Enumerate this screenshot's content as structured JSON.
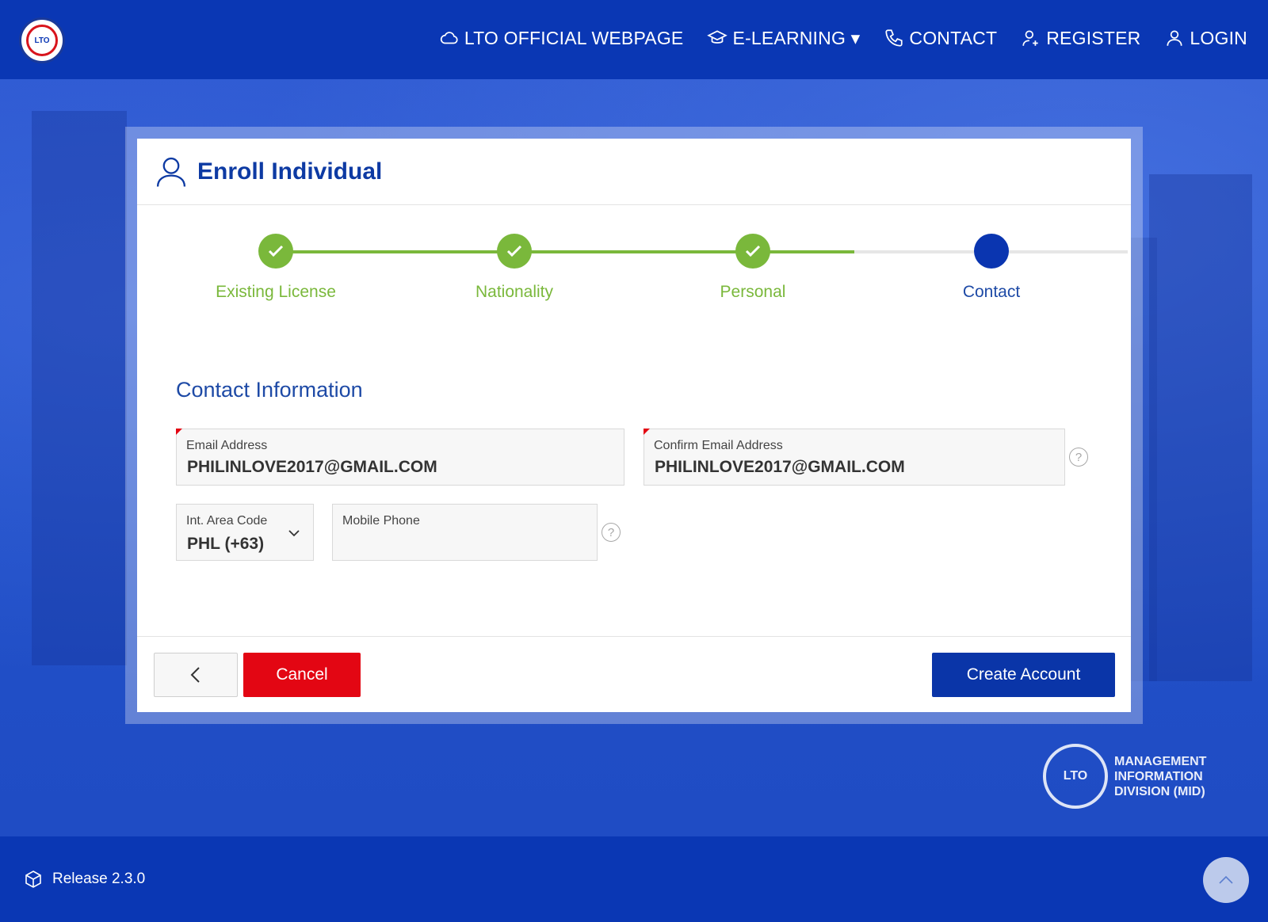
{
  "header": {
    "logo_text": "LTO",
    "nav": [
      {
        "label": "LTO OFFICIAL WEBPAGE",
        "icon": "cloud-icon"
      },
      {
        "label": "E-LEARNING ▾",
        "icon": "graduation-cap-icon"
      },
      {
        "label": "CONTACT",
        "icon": "phone-icon"
      },
      {
        "label": "REGISTER",
        "icon": "add-user-icon"
      },
      {
        "label": "LOGIN",
        "icon": "user-icon"
      }
    ]
  },
  "card": {
    "title": "Enroll Individual",
    "steps": [
      {
        "label": "Existing License",
        "status": "complete"
      },
      {
        "label": "Nationality",
        "status": "complete"
      },
      {
        "label": "Personal",
        "status": "complete"
      },
      {
        "label": "Contact",
        "status": "current"
      }
    ],
    "section_title": "Contact Information",
    "fields": {
      "email": {
        "label": "Email Address",
        "value": "PHILINLOVE2017@GMAIL.COM"
      },
      "confirm_email": {
        "label": "Confirm Email Address",
        "value": "PHILINLOVE2017@GMAIL.COM"
      },
      "area_code": {
        "label": "Int. Area Code",
        "value": "PHL (+63)"
      },
      "mobile": {
        "label": "Mobile Phone",
        "value": ""
      }
    },
    "help_glyph": "?",
    "buttons": {
      "back": "‹",
      "cancel": "Cancel",
      "create": "Create Account"
    }
  },
  "branding": {
    "mid_lines": [
      "MANAGEMENT",
      "INFORMATION",
      "DIVISION (MID)"
    ],
    "mid_emblem": "LTO"
  },
  "footer": {
    "release": "Release 2.3.0"
  },
  "colors": {
    "primary": "#0a37b4",
    "success": "#7ab83b",
    "danger": "#e30613",
    "current_step": "#0a35b0"
  }
}
